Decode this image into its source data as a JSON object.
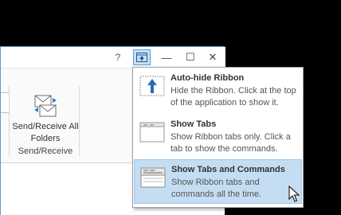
{
  "window": {
    "titlebar": {
      "help_label": "?",
      "minimize_label": "—",
      "maximize_label": "☐",
      "close_label": "✕"
    },
    "ribbon": {
      "send_receive_button_label": "Send/Receive All Folders",
      "group_label": "Send/Receive"
    }
  },
  "ribbon_display_menu": {
    "items": [
      {
        "title": "Auto-hide Ribbon",
        "description": "Hide the Ribbon. Click at the top of the application to show it.",
        "icon": "auto-hide-icon",
        "highlighted": false
      },
      {
        "title": "Show Tabs",
        "description": "Show Ribbon tabs only. Click a tab to show the commands.",
        "icon": "show-tabs-icon",
        "highlighted": false
      },
      {
        "title": "Show Tabs and Commands",
        "description": "Show Ribbon tabs and commands all the time.",
        "icon": "show-tabs-commands-icon",
        "highlighted": true
      }
    ]
  },
  "colors": {
    "accent": "#5b9bd5",
    "highlight": "#c5ddf2",
    "background": "#000000"
  }
}
